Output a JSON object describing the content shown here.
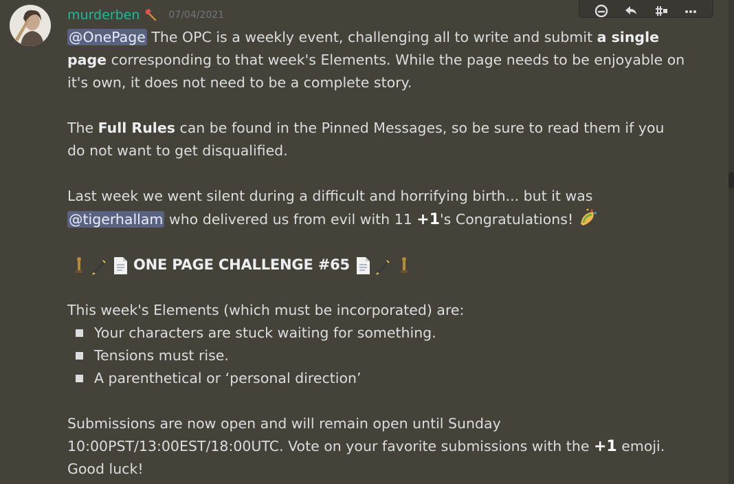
{
  "message": {
    "username": "murderben",
    "timestamp": "07/04/2021",
    "username_color": "#1abc9c",
    "badge_icon": "axe-icon",
    "mention_onepage": "@OnePage",
    "p1_a": " The OPC is a weekly event, challenging all to write and submit ",
    "p1_bold": "a single page",
    "p1_b": " corresponding to that week's Elements. While the page needs to be enjoyable on it's own, it does not need to be a complete story.",
    "p2_a": "The ",
    "p2_bold": "Full Rules",
    "p2_b": " can be found in the Pinned Messages, so be sure to read them if you do not want to get disqualified.",
    "p3_a": "Last week we went silent during a difficult and horrifying birth... but it was ",
    "mention_tiger": "@tigerhallam",
    "p3_b": " who delivered us from evil with 11 ",
    "plus_one": "+1",
    "p3_c": "'s Congratulations! ",
    "challenge_title": "ONE PAGE CHALLENGE #65",
    "elements_intro": "This week's Elements (which must be incorporated) are:",
    "elements": [
      "Your characters are stuck waiting for something.",
      "Tensions must rise.",
      "A parenthetical or ‘personal direction’"
    ],
    "p5_a": "Submissions are now open and will remain open until Sunday 10:00PST/13:00EST/18:00UTC. Vote on your favorite submissions with the ",
    "p5_b": " emoji. Good luck!"
  },
  "toolbar": {
    "icons": [
      "add-reaction-icon",
      "reply-icon",
      "create-thread-icon",
      "more-icon"
    ]
  },
  "colors": {
    "background": "#45423a",
    "mention_bg": "#5865a0",
    "timestamp": "#72767d"
  }
}
